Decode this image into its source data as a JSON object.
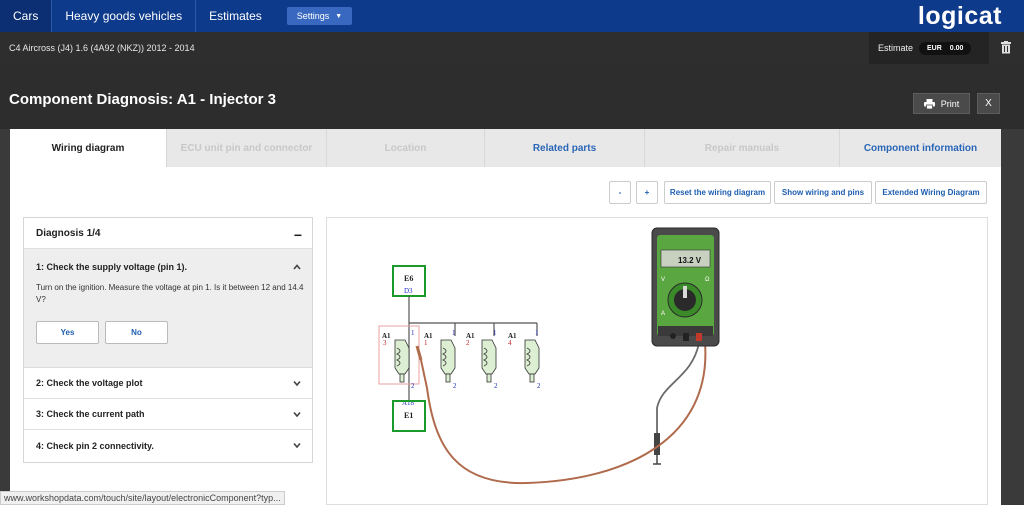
{
  "nav": {
    "items": [
      "Cars",
      "Heavy goods vehicles",
      "Estimates"
    ],
    "settings_label": "Settings",
    "logo": "logicat"
  },
  "vehicle": {
    "title": "C4 Aircross (J4) 1.6 (4A92 (NKZ)) 2012 - 2014",
    "estimate_label": "Estimate",
    "currency": "EUR",
    "amount": "0.00"
  },
  "modal": {
    "title": "Component Diagnosis: A1 - Injector 3",
    "print_label": "Print",
    "close_label": "X"
  },
  "tabs": [
    {
      "label": "Wiring diagram",
      "state": "active"
    },
    {
      "label": "ECU unit pin and connector",
      "state": "disabled"
    },
    {
      "label": "Location",
      "state": "disabled"
    },
    {
      "label": "Related parts",
      "state": "link"
    },
    {
      "label": "Repair manuals",
      "state": "disabled"
    },
    {
      "label": "Component information",
      "state": "link"
    }
  ],
  "toolbar": {
    "minus": "-",
    "plus": "+",
    "reset": "Reset the wiring diagram",
    "show": "Show wiring and pins",
    "extended": "Extended Wiring Diagram"
  },
  "diagnosis": {
    "title": "Diagnosis 1/4",
    "collapse": "−",
    "open_step": {
      "title": "1: Check the supply voltage (pin 1).",
      "text": "Turn on the ignition. Measure the voltage at pin 1. Is it between 12 and 14.4 V?",
      "yes": "Yes",
      "no": "No"
    },
    "steps": [
      "2: Check the voltage plot",
      "3: Check the current path",
      "4: Check pin 2 connectivity."
    ]
  },
  "diagram": {
    "top_component": "E6",
    "top_pin": "D3",
    "bottom_component": "E1",
    "bottom_pin": "A18",
    "injectors": [
      {
        "name": "A1",
        "number": "3",
        "pin_top": "1",
        "pin_bottom": "2"
      },
      {
        "name": "A1",
        "number": "1",
        "pin_top": "1",
        "pin_bottom": "2"
      },
      {
        "name": "A1",
        "number": "2",
        "pin_top": "1",
        "pin_bottom": "2"
      },
      {
        "name": "A1",
        "number": "4",
        "pin_top": "1",
        "pin_bottom": "2"
      }
    ],
    "meter_reading": "13.2 V",
    "meter_labels": [
      "V",
      "Ω",
      "A"
    ]
  },
  "status_url": "www.workshopdata.com/touch/site/layout/electronicComponent?typ...",
  "colors": {
    "nav_bg": "#0e3a8c",
    "link": "#2a66b8",
    "meter_green": "#5aa640",
    "probe_wire": "#b06a4c",
    "component_box": "#1a9a2a"
  }
}
